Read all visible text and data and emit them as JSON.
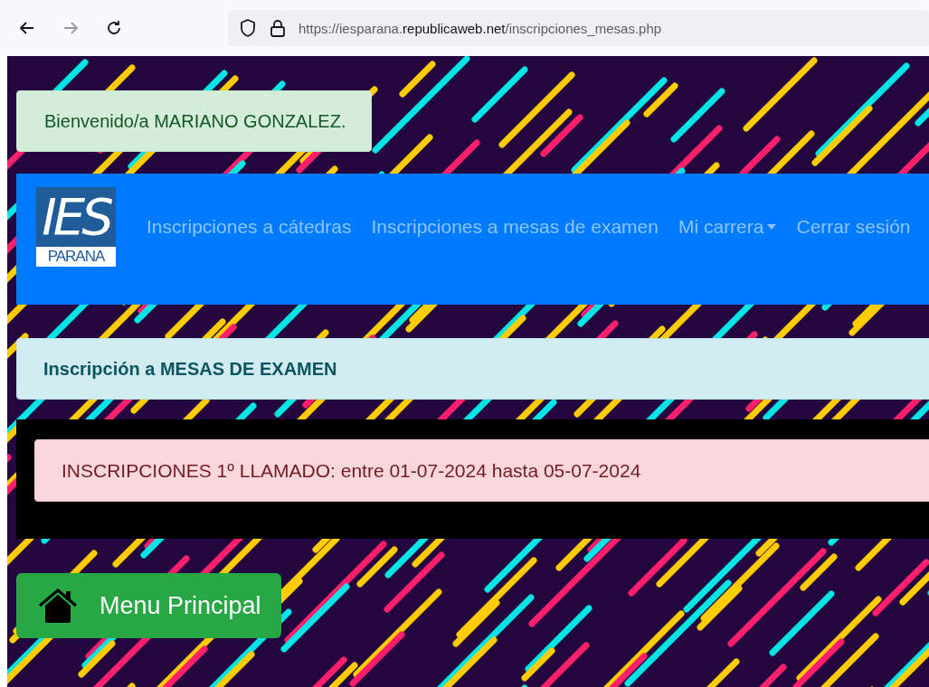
{
  "browser": {
    "url_parts": [
      {
        "text": "https://iesparana.",
        "emphasis": false
      },
      {
        "text": "republicaweb.net",
        "emphasis": true
      },
      {
        "text": "/inscripciones_mesas.php",
        "emphasis": false
      }
    ]
  },
  "welcome": "Bienvenido/a MARIANO GONZALEZ.",
  "navbar": {
    "logo": {
      "top": "IES",
      "bottom": "PARANA"
    },
    "items": [
      {
        "label": "Inscripciones a cátedras",
        "kind": "link"
      },
      {
        "label": "Inscripciones a mesas de examen",
        "kind": "link"
      },
      {
        "label": "Mi carrera",
        "kind": "dropdown"
      },
      {
        "label": "Cerrar sesión",
        "kind": "link"
      }
    ]
  },
  "section_title": "Inscripción a MESAS DE EXAMEN",
  "notice": "INSCRIPCIONES 1º LLAMADO: entre 01-07-2024 hasta 05-07-2024",
  "menu_button": "Menu Principal"
}
